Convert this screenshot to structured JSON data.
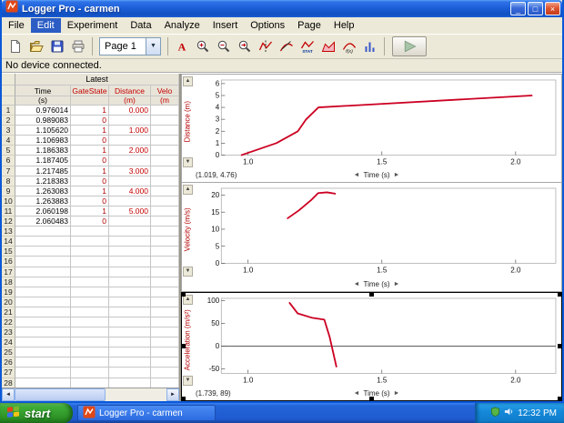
{
  "window": {
    "title": "Logger Pro - carmen"
  },
  "menu": {
    "items": [
      "File",
      "Edit",
      "Experiment",
      "Data",
      "Analyze",
      "Insert",
      "Options",
      "Page",
      "Help"
    ],
    "active": "Edit"
  },
  "toolbar": {
    "page_selector": "Page 1",
    "file_buttons": [
      "new-file",
      "open-file",
      "save",
      "print"
    ],
    "graph_buttons": [
      "autoscale",
      "zoom-in",
      "zoom-out",
      "zoom-undo",
      "examine",
      "tangent",
      "statistics",
      "integrate",
      "curve-fit",
      "fft"
    ],
    "collect_button": "collect",
    "collect_disabled": true
  },
  "status": "No device connected.",
  "table": {
    "title": "Latest",
    "row_count": 28,
    "columns": [
      {
        "name": "Time",
        "unit": "(s)",
        "color": "#000000"
      },
      {
        "name": "GateState",
        "unit": "",
        "color": "#c40000"
      },
      {
        "name": "Distance",
        "unit": "(m)",
        "color": "#c40000"
      },
      {
        "name": "Velo",
        "unit": "(m",
        "color": "#c40000"
      }
    ],
    "rows": [
      [
        "0.976014",
        "1",
        "0.000"
      ],
      [
        "0.989083",
        "0",
        ""
      ],
      [
        "1.105620",
        "1",
        "1.000"
      ],
      [
        "1.106983",
        "0",
        ""
      ],
      [
        "1.186383",
        "1",
        "2.000"
      ],
      [
        "1.187405",
        "0",
        ""
      ],
      [
        "1.217485",
        "1",
        "3.000"
      ],
      [
        "1.218383",
        "0",
        ""
      ],
      [
        "1.263083",
        "1",
        "4.000"
      ],
      [
        "1.263883",
        "0",
        ""
      ],
      [
        "2.060198",
        "1",
        "5.000"
      ],
      [
        "2.060483",
        "0",
        ""
      ]
    ]
  },
  "chart_data": [
    {
      "type": "line",
      "ylabel": "Distance (m)",
      "xlabel": "Time (s)",
      "xlim": [
        0.9,
        2.15
      ],
      "ylim": [
        0,
        6.3
      ],
      "xticks": [
        1.0,
        1.5,
        2.0
      ],
      "yticks": [
        0,
        1,
        2,
        3,
        4,
        5,
        6
      ],
      "readout": "(1.019, 4.76)",
      "selected": false,
      "zero_line": false,
      "series": [
        {
          "name": "Distance",
          "color": "#cc0022",
          "points": [
            [
              0.976,
              0.0
            ],
            [
              1.106,
              1.0
            ],
            [
              1.186,
              2.0
            ],
            [
              1.217,
              3.0
            ],
            [
              1.263,
              4.0
            ],
            [
              2.06,
              5.0
            ]
          ]
        }
      ]
    },
    {
      "type": "line",
      "ylabel": "Velocity (m/s)",
      "xlabel": "Time (s)",
      "xlim": [
        0.9,
        2.15
      ],
      "ylim": [
        0,
        22
      ],
      "xticks": [
        1.0,
        1.5,
        2.0
      ],
      "yticks": [
        0,
        5,
        10,
        15,
        20
      ],
      "readout": "",
      "selected": false,
      "zero_line": false,
      "series": [
        {
          "name": "Velocity",
          "color": "#cc0022",
          "points": [
            [
              1.148,
              13.2
            ],
            [
              1.19,
              15.5
            ],
            [
              1.235,
              18.5
            ],
            [
              1.262,
              20.6
            ],
            [
              1.295,
              20.8
            ],
            [
              1.325,
              20.4
            ]
          ]
        }
      ]
    },
    {
      "type": "line",
      "ylabel": "Acceleration (m/s²)",
      "xlabel": "Time (s)",
      "xlim": [
        0.9,
        2.15
      ],
      "ylim": [
        -60,
        105
      ],
      "xticks": [
        1.0,
        1.5,
        2.0
      ],
      "yticks": [
        -50,
        0,
        50,
        100
      ],
      "readout": "(1.739, 89)",
      "selected": true,
      "zero_line": true,
      "series": [
        {
          "name": "Acceleration",
          "color": "#cc0022",
          "points": [
            [
              1.155,
              95
            ],
            [
              1.185,
              72
            ],
            [
              1.24,
              62
            ],
            [
              1.285,
              58
            ],
            [
              1.305,
              20
            ],
            [
              1.33,
              -45
            ]
          ]
        }
      ]
    }
  ],
  "taskbar": {
    "start_label": "start",
    "task_label": "Logger Pro - carmen",
    "time": "12:32 PM"
  }
}
